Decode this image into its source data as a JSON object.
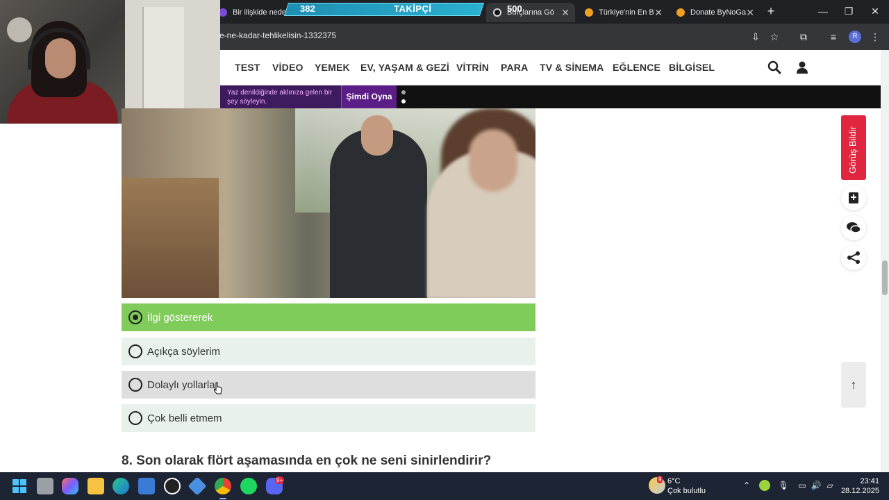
{
  "browser": {
    "tabs": [
      {
        "title": "Bir ilişkide neden"
      },
      {
        "title": "Burçlarına Gö"
      },
      {
        "title": "Türkiye'nin En B"
      },
      {
        "title": "Donate ByNoGa"
      }
    ],
    "url": "e-ne-kadar-tehlikelisin-1332375",
    "profile_initial": "R"
  },
  "overlay": {
    "follower_current": "382",
    "follower_label": "TAKİPÇİ",
    "follower_goal": "500"
  },
  "site_nav": {
    "items": [
      "TEST",
      "VİDEO",
      "YEMEK",
      "EV, YAŞAM & GEZİ",
      "VİTRİN",
      "PARA",
      "TV & SİNEMA",
      "EĞLENCE",
      "BİLGİSEL"
    ]
  },
  "promo": {
    "text": "Yaz denildiğinde aklınıza gelen bir şey söyleyin.",
    "button": "Şimdi Oyna"
  },
  "quiz": {
    "options": [
      {
        "label": "İlgi göstererek",
        "selected": true
      },
      {
        "label": "Açıkça söylerim",
        "selected": false
      },
      {
        "label": "Dolaylı yollarla",
        "selected": false
      },
      {
        "label": "Çok belli etmem",
        "selected": false
      }
    ],
    "next_question": "8. Son olarak flört aşamasında en çok ne seni sinirlendirir?"
  },
  "sidebar": {
    "feedback_label": "Görüş Bildir"
  },
  "taskbar": {
    "weather_temp": "6°C",
    "weather_desc": "Çok bulutlu",
    "weather_badge": "9",
    "discord_badge": "9+",
    "time": "23:41",
    "date": "28.12.2025"
  },
  "colors": {
    "selected_option": "#80cc5a",
    "option_bg": "#e8f1ec",
    "feedback": "#e0263e",
    "promo_purple": "#5b1d86"
  }
}
